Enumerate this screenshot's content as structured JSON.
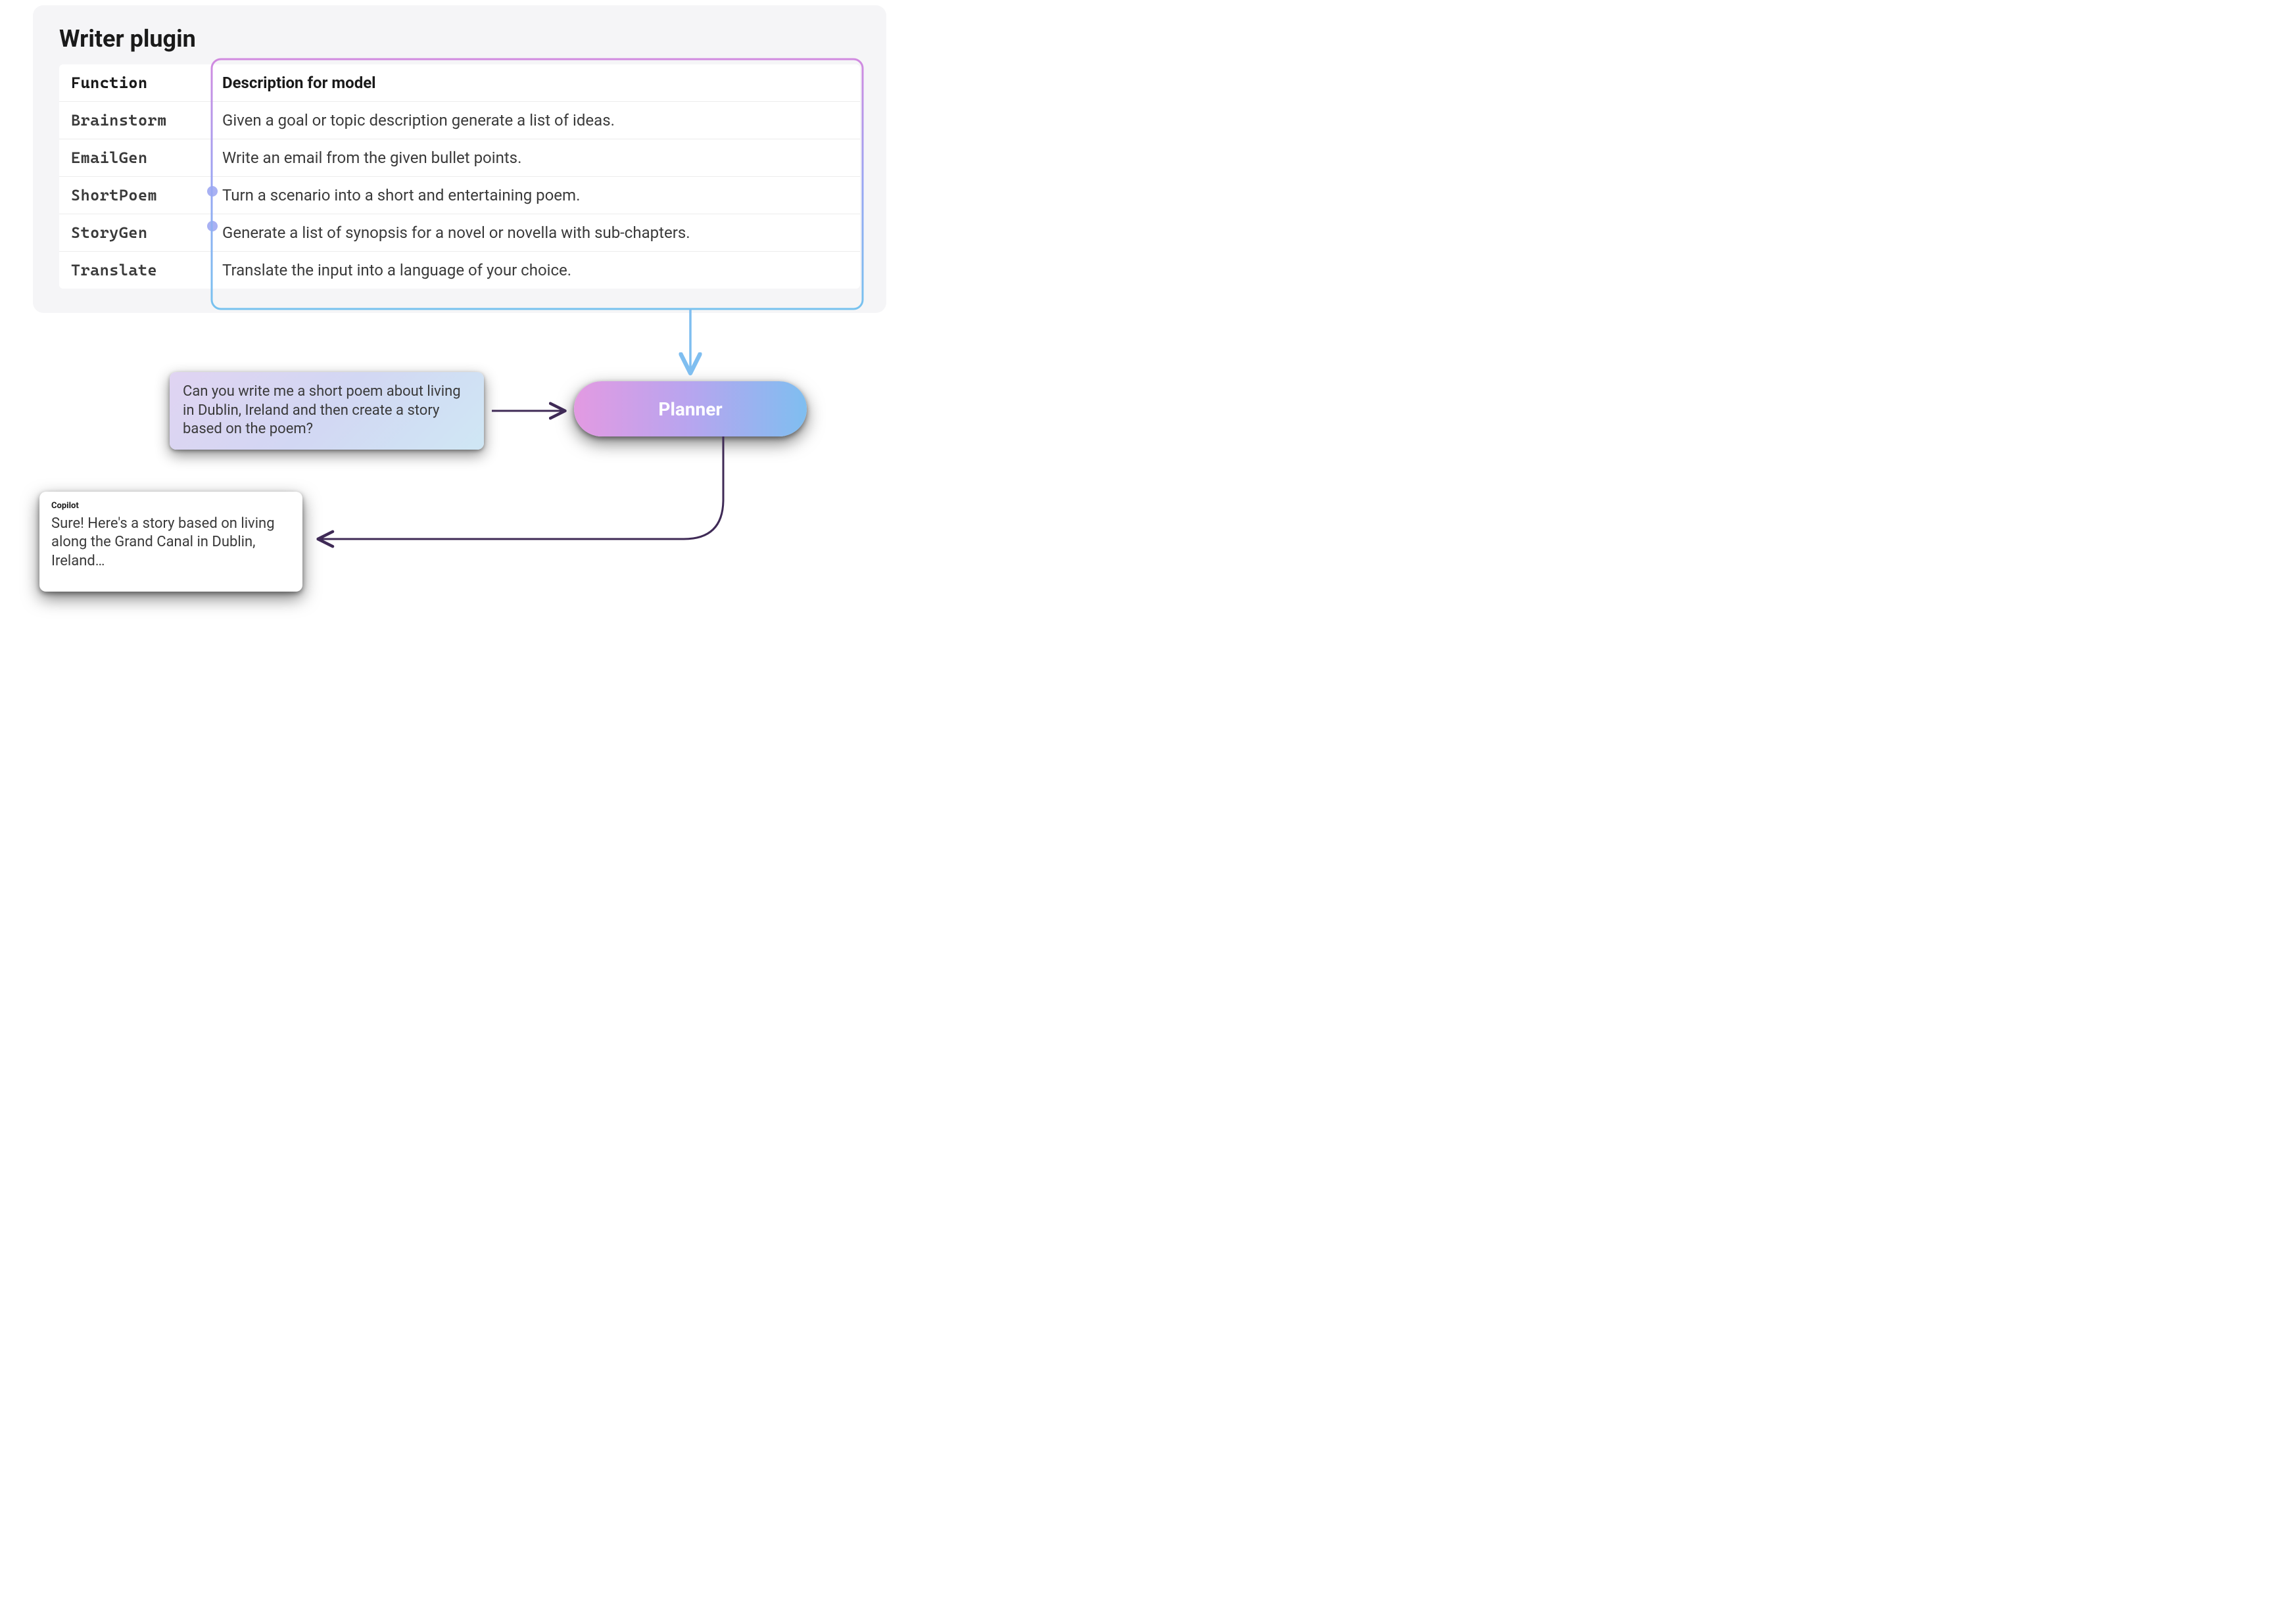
{
  "card": {
    "title": "Writer plugin",
    "headers": {
      "func": "Function",
      "desc": "Description for model"
    },
    "rows": [
      {
        "func": "Brainstorm",
        "desc": "Given a goal or topic description generate a list of ideas."
      },
      {
        "func": "EmailGen",
        "desc": "Write an email from the given bullet points."
      },
      {
        "func": "ShortPoem",
        "desc": "Turn a scenario into a short and entertaining poem."
      },
      {
        "func": "StoryGen",
        "desc": "Generate a list of synopsis for a novel or novella with sub-chapters."
      },
      {
        "func": "Translate",
        "desc": "Translate the input into a language of your choice."
      }
    ]
  },
  "prompt": {
    "text": "Can you write me a short poem about living in Dublin, Ireland and then create a story based on the poem?"
  },
  "planner": {
    "label": "Planner"
  },
  "reply": {
    "who": "Copilot",
    "text": "Sure! Here's a story based on living along the Grand Canal in Dublin, Ireland…"
  }
}
